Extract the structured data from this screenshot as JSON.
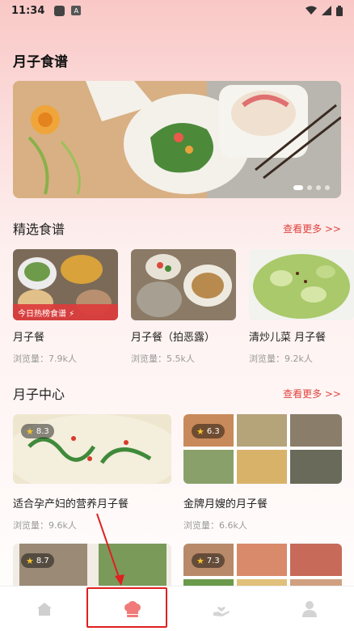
{
  "status_bar": {
    "time": "11:34",
    "a_badge": "A"
  },
  "page_title": "月子食谱",
  "banner": {
    "dots": 4,
    "active_dot": 0
  },
  "featured": {
    "title": "精选食谱",
    "see_more": "查看更多 >>",
    "cards": [
      {
        "name": "月子餐",
        "views": "浏览量：7.9k人",
        "tag": "今日热榜食谱 ⚡"
      },
      {
        "name": "月子餐（拍恶露）",
        "views": "浏览量：5.5k人"
      },
      {
        "name": "清炒儿菜 月子餐",
        "views": "浏览量：9.2k人"
      }
    ]
  },
  "center": {
    "title": "月子中心",
    "see_more": "查看更多 >>",
    "cards": [
      {
        "name": "适合孕产妇的营养月子餐",
        "views": "浏览量：9.6k人",
        "rating": "8.3"
      },
      {
        "name": "金牌月嫂的月子餐",
        "views": "浏览量：6.6k人",
        "rating": "6.3"
      },
      {
        "rating": "8.7"
      },
      {
        "rating": "7.3"
      }
    ]
  },
  "tabs": [
    {
      "icon": "home-icon"
    },
    {
      "icon": "chef-hat-icon",
      "active": true,
      "color": "#f07a7a"
    },
    {
      "icon": "care-hand-icon"
    },
    {
      "icon": "user-icon"
    }
  ],
  "colors": {
    "accent": "#e0443f",
    "highlight": "#e02020"
  }
}
